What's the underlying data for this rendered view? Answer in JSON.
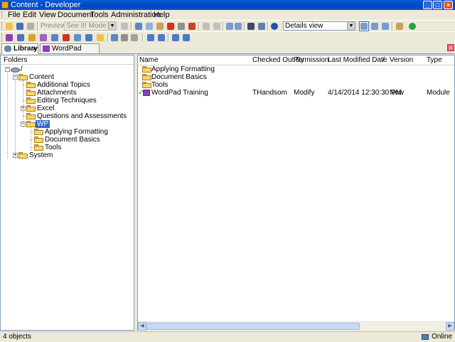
{
  "window": {
    "title": "Content - Developer"
  },
  "menu": [
    "File",
    "Edit",
    "View",
    "Document",
    "Tools",
    "Administration",
    "Help"
  ],
  "toolbar": {
    "preview_label": "Preview",
    "mode_combo": "See It! Mode",
    "view_combo": "Details view"
  },
  "tabs": [
    {
      "label": "Library",
      "active": true
    },
    {
      "label": "WordPad Training",
      "active": false
    }
  ],
  "folders": {
    "header": "Folders",
    "root": "/",
    "content": "Content",
    "additional_topics": "Additional Topics",
    "attachments": "Attachments",
    "editing_techniques": "Editing Techniques",
    "excel": "Excel",
    "questions": "Questions and Assessments",
    "wp": "WP",
    "wp_applying": "Applying Formatting",
    "wp_document": "Document Basics",
    "wp_tools": "Tools",
    "system": "System"
  },
  "list": {
    "columns": {
      "name": "Name",
      "checked_out_by": "Checked Out By",
      "permission": "Permission",
      "last_modified": "Last Modified Date",
      "sort_marker": "/",
      "version": "Version",
      "type": "Type"
    },
    "rows": [
      {
        "name": "Applying Formatting",
        "checked_out_by": "",
        "permission": "",
        "last_modified": "",
        "version": "",
        "type": ""
      },
      {
        "name": "Document Basics",
        "checked_out_by": "",
        "permission": "",
        "last_modified": "",
        "version": "",
        "type": ""
      },
      {
        "name": "Tools",
        "checked_out_by": "",
        "permission": "",
        "last_modified": "",
        "version": "",
        "type": ""
      },
      {
        "name": "WordPad Training",
        "checked_out_by": "THandsom",
        "permission": "Modify",
        "last_modified": "4/14/2014 12:30:30 PM",
        "version": "New",
        "type": "Module"
      }
    ]
  },
  "status": {
    "count": "4 objects",
    "connection": "Online"
  },
  "icons": {
    "folder": "folder-icon",
    "module": "module-icon",
    "check": "checkmark-icon"
  },
  "colors": {
    "titlebar": "#0a53cf",
    "selection": "#316ac5",
    "folder": "#f8d66a",
    "module": "#8e3fb8"
  }
}
